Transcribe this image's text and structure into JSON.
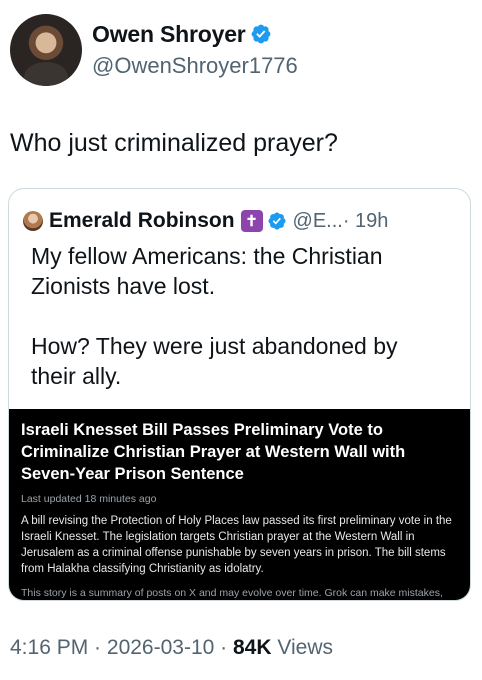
{
  "author": {
    "name": "Owen Shroyer",
    "handle": "@OwenShroyer1776"
  },
  "tweet": {
    "text": "Who just criminalized prayer?"
  },
  "quoted": {
    "name": "Emerald Robinson",
    "badge_glyph": "✝",
    "handle": "@E...",
    "time": "· 19h",
    "paragraph1_line1": "My fellow Americans: the Christian",
    "paragraph1_line2": "Zionists have lost.",
    "paragraph2_line1": "How? They were just abandoned by",
    "paragraph2_line2": "their ally."
  },
  "grok_card": {
    "headline": "Israeli Knesset Bill Passes Preliminary Vote to Criminalize Christian Prayer at Western Wall with Seven-Year Prison Sentence",
    "updated": "Last updated 18 minutes ago",
    "body": "A bill revising the Protection of Holy Places law passed its first preliminary vote in the Israeli Knesset. The legislation targets Christian prayer at the Western Wall in Jerusalem as a criminal offense punishable by seven years in prison. The bill stems from Halakha classifying Christianity as idolatry.",
    "disclaimer": "This story is a summary of posts on X and may evolve over time. Grok can make mistakes, verify its outputs."
  },
  "meta": {
    "time": "4:16 PM",
    "sep1": " · ",
    "date": "2026-03-10",
    "sep2": " · ",
    "views_count": "84K",
    "views_label": " Views"
  },
  "colors": {
    "verified": "#1d9bf0",
    "secondary_text": "#536471",
    "card_background": "#000000",
    "badge": "#8e44ad"
  },
  "icons": {
    "verified": "verified-badge-icon",
    "cross": "cross-badge-icon"
  }
}
